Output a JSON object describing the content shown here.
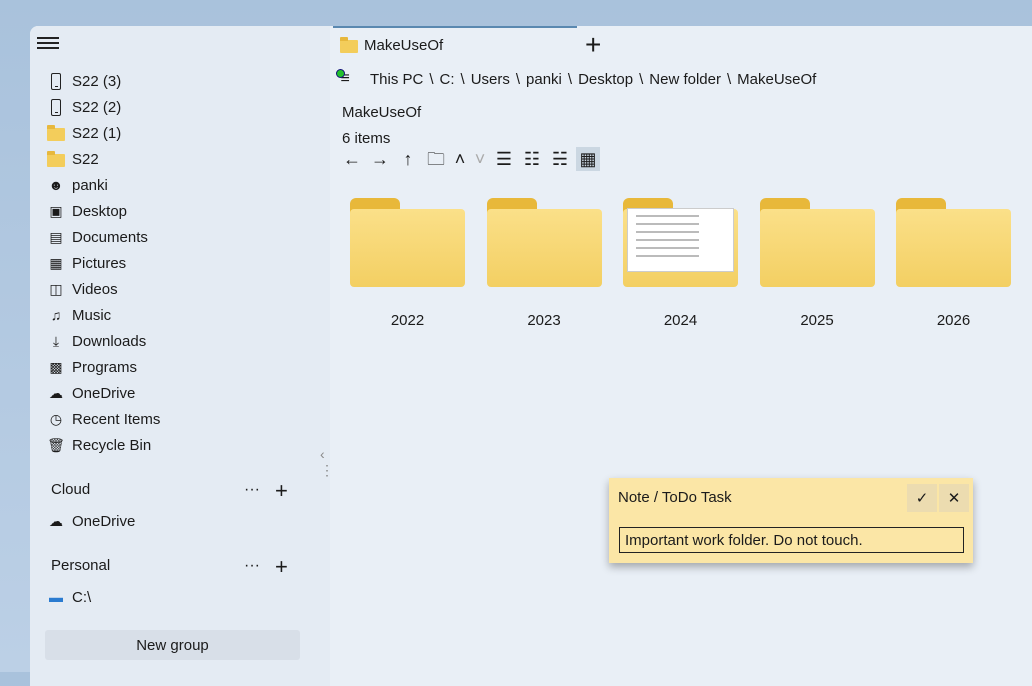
{
  "sidebar": {
    "items": [
      {
        "label": "S22 (3)",
        "icon": "phone-icon"
      },
      {
        "label": "S22 (2)",
        "icon": "phone-icon"
      },
      {
        "label": "S22 (1)",
        "icon": "folder-icon"
      },
      {
        "label": "S22",
        "icon": "folder-icon"
      },
      {
        "label": "panki",
        "icon": "user-icon"
      },
      {
        "label": "Desktop",
        "icon": "desktop-icon"
      },
      {
        "label": "Documents",
        "icon": "documents-icon"
      },
      {
        "label": "Pictures",
        "icon": "pictures-icon"
      },
      {
        "label": "Videos",
        "icon": "videos-icon"
      },
      {
        "label": "Music",
        "icon": "music-icon"
      },
      {
        "label": "Downloads",
        "icon": "download-icon"
      },
      {
        "label": "Programs",
        "icon": "programs-icon"
      },
      {
        "label": "OneDrive",
        "icon": "cloud-icon"
      },
      {
        "label": "Recent Items",
        "icon": "history-icon"
      },
      {
        "label": "Recycle Bin",
        "icon": "trash-icon"
      }
    ],
    "groups": [
      {
        "title": "Cloud",
        "item": "OneDrive"
      },
      {
        "title": "Personal",
        "item": "C:\\"
      }
    ],
    "new_group": "New group"
  },
  "tab": {
    "label": "MakeUseOf"
  },
  "breadcrumb": [
    "This PC",
    "C:",
    "Users",
    "panki",
    "Desktop",
    "New folder",
    "MakeUseOf"
  ],
  "folder_title": "MakeUseOf",
  "item_count": "6 items",
  "items": [
    "2022",
    "2023",
    "2024",
    "2025",
    "2026"
  ],
  "note": {
    "title": "Note / ToDo Task",
    "value": "Important work folder. Do not touch."
  }
}
